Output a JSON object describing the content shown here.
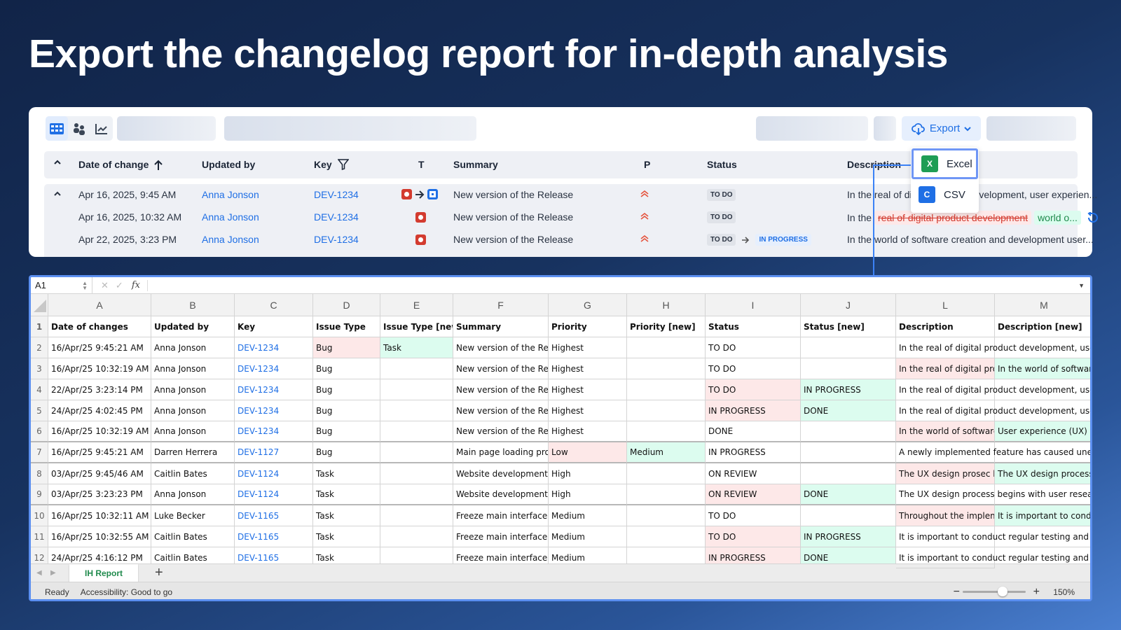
{
  "title": "Export the changelog report for in-depth analysis",
  "app": {
    "export_label": "Export",
    "export_menu": [
      {
        "label": "Excel",
        "icon": "X"
      },
      {
        "label": "CSV",
        "icon": "C"
      }
    ],
    "columns": {
      "date": "Date of change",
      "updated": "Updated by",
      "key": "Key",
      "type": "T",
      "summary": "Summary",
      "priority": "P",
      "status": "Status",
      "description": "Description"
    },
    "rows": [
      {
        "date": "Apr 16, 2025, 9:45 AM",
        "user": "Anna Jonson",
        "key": "DEV-1234",
        "summary": "New version of the Release",
        "status": "TO DO",
        "desc": "In the real of digital product development, user experien..."
      },
      {
        "date": "Apr 16, 2025, 10:32 AM",
        "user": "Anna Jonson",
        "key": "DEV-1234",
        "summary": "New version of the Release",
        "status": "TO DO",
        "desc_prefix": "In the",
        "desc_removed": "real of digital product development",
        "desc_added": "world o..."
      },
      {
        "date": "Apr 22, 2025, 3:23 PM",
        "user": "Anna Jonson",
        "key": "DEV-1234",
        "summary": "New version of the Release",
        "status": "TO DO",
        "status_new": "IN PROGRESS",
        "desc": "In the world of software creation and development user..."
      }
    ]
  },
  "sheet": {
    "cell_ref": "A1",
    "fx": "fx",
    "col_letters": [
      "A",
      "B",
      "C",
      "D",
      "E",
      "F",
      "G",
      "H",
      "I",
      "J",
      "L",
      "M"
    ],
    "header": [
      "Date of changes",
      "Updated by",
      "Key",
      "Issue Type",
      "Issue Type [new]",
      "Summary",
      "Priority",
      "Priority [new]",
      "Status",
      "Status [new]",
      "Description",
      "Description [new]"
    ],
    "rows": [
      {
        "n": "2",
        "cells": [
          "16/Apr/25 9:45:21 AM",
          "Anna Jonson",
          "DEV-1234",
          "Bug",
          "Task",
          "New version of the Release",
          "Highest",
          "",
          "TO DO",
          "",
          "In the real of digital product development, user experience",
          ""
        ],
        "old": [
          3
        ],
        "new": [
          4
        ]
      },
      {
        "n": "3",
        "cells": [
          "16/Apr/25 10:32:19 AM",
          "Anna Jonson",
          "DEV-1234",
          "Bug",
          "",
          "New version of the Release",
          "Highest",
          "",
          "TO DO",
          "",
          "In the real of digital product development",
          "In the world of software creation"
        ],
        "old": [
          10
        ],
        "new": [
          11
        ]
      },
      {
        "n": "4",
        "cells": [
          "22/Apr/25 3:23:14 PM",
          "Anna Jonson",
          "DEV-1234",
          "Bug",
          "",
          "New version of the Release",
          "Highest",
          "",
          "TO DO",
          "IN PROGRESS",
          "In the real of digital product development, user experience",
          ""
        ],
        "old": [
          8
        ],
        "new": [
          9
        ]
      },
      {
        "n": "5",
        "cells": [
          "24/Apr/25 4:02:45 PM",
          "Anna Jonson",
          "DEV-1234",
          "Bug",
          "",
          "New version of the Release",
          "Highest",
          "",
          "IN PROGRESS",
          "DONE",
          "In the real of digital product development, user experience",
          ""
        ],
        "old": [
          8
        ],
        "new": [
          9
        ]
      },
      {
        "n": "6",
        "cells": [
          "16/Apr/25 10:32:19 AM",
          "Anna Jonson",
          "DEV-1234",
          "Bug",
          "",
          "New version of the Release",
          "Highest",
          "",
          "DONE",
          "",
          "In the world of software creation",
          "User experience (UX) design"
        ],
        "old": [
          10
        ],
        "new": [
          11
        ],
        "sep": true
      },
      {
        "n": "7",
        "cells": [
          "16/Apr/25 9:45:21 AM",
          "Darren Herrera",
          "DEV-1127",
          "Bug",
          "",
          "Main page loading problem",
          "Low",
          "Medium",
          "IN PROGRESS",
          "",
          "A newly implemented feature has caused unexpected",
          ""
        ],
        "old": [
          6
        ],
        "new": [
          7
        ],
        "sep": true
      },
      {
        "n": "8",
        "cells": [
          "03/Apr/25 9:45/46 AM",
          "Caitlin Bates",
          "DEV-1124",
          "Task",
          "",
          "Website development",
          "High",
          "",
          "ON REVIEW",
          "",
          "The UX design prosec begins",
          "The UX design process begins"
        ],
        "old": [
          10
        ],
        "new": [
          11
        ]
      },
      {
        "n": "9",
        "cells": [
          "03/Apr/25 3:23:23 PM",
          "Anna Jonson",
          "DEV-1124",
          "Task",
          "",
          "Website development",
          "High",
          "",
          "ON REVIEW",
          "DONE",
          "The UX design process begins with user research",
          ""
        ],
        "old": [
          8
        ],
        "new": [
          9
        ],
        "sep": true
      },
      {
        "n": "10",
        "cells": [
          "16/Apr/25 10:32:11 AM",
          "Luke Becker",
          "DEV-1165",
          "Task",
          "",
          "Freeze main interface",
          "Medium",
          "",
          "TO DO",
          "",
          "Throughout the implementation",
          "It is important to conduct"
        ],
        "old": [
          10
        ],
        "new": [
          11
        ]
      },
      {
        "n": "11",
        "cells": [
          "16/Apr/25 10:32:55 AM",
          "Caitlin Bates",
          "DEV-1165",
          "Task",
          "",
          "Freeze main interface",
          "Medium",
          "",
          "TO DO",
          "IN PROGRESS",
          "It is important to conduct regular testing and quality",
          ""
        ],
        "old": [
          8
        ],
        "new": [
          9
        ]
      },
      {
        "n": "12",
        "cells": [
          "24/Apr/25 4:16:12 PM",
          "Caitlin Bates",
          "DEV-1165",
          "Task",
          "",
          "Freeze main interface",
          "Medium",
          "",
          "IN PROGRESS",
          "DONE",
          "It is important to conduct regular testing and quality",
          ""
        ],
        "old": [
          8
        ],
        "new": [
          9
        ]
      }
    ],
    "tab_label": "IH Report",
    "add_sheet": "+",
    "status_ready": "Ready",
    "status_access": "Accessibility: Good to go",
    "zoom": "150%",
    "zoom_minus": "−",
    "zoom_plus": "+"
  },
  "colors": {
    "accent": "#1f6fe5",
    "old": "#fde8e8",
    "new": "#dcfcef",
    "excel": "#1f9d55",
    "csv": "#1f6fe5"
  }
}
